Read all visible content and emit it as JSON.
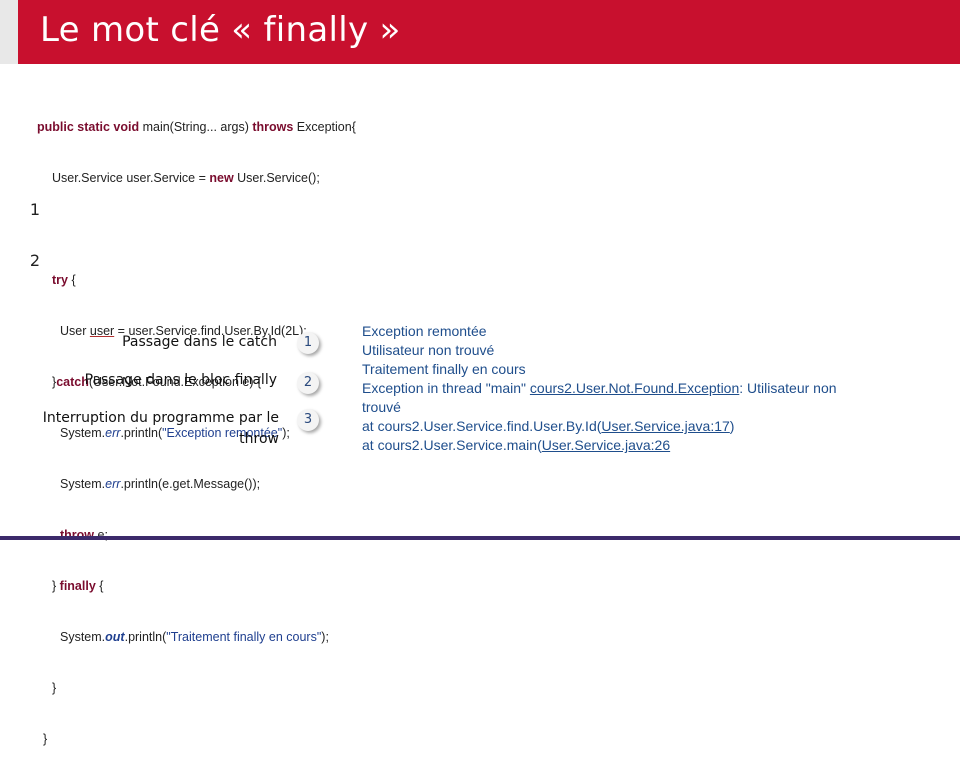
{
  "header": {
    "title": "Le mot clé « finally »"
  },
  "code": {
    "l1_kw1": "public static void",
    "l1_rest": " main(String... args) ",
    "l1_kw2": "throws",
    "l1_end": " Exception{",
    "l2_a": "User.Service user.Service = ",
    "l2_kw": "new",
    "l2_b": " User.Service();",
    "l3_kw": "try",
    "l3_end": " {",
    "l4_a": "User ",
    "l4_var": "user",
    "l4_b": " = user.Service.find.User.By.Id(2L);",
    "l5_a": "}",
    "l5_kw": "catch",
    "l5_b": "(User.Not.Found.Exception e) {",
    "l6_a": "System.",
    "l6_err": "err",
    "l6_b": ".println(",
    "l6_str": "\"Exception remontée\"",
    "l6_c": ");",
    "l7_a": "System.",
    "l7_err": "err",
    "l7_b": ".println(e.get.Message());",
    "l8_kw": "throw",
    "l8_b": " e;",
    "l9_a": "} ",
    "l9_kw": "finally",
    "l9_b": " {",
    "l10_a": "System.",
    "l10_out": "out",
    "l10_b": ".println(",
    "l10_str": "\"Traitement finally en cours\"",
    "l10_c": ");",
    "l11": "}",
    "l12": "}"
  },
  "markers": {
    "m1": "1",
    "m2": "2"
  },
  "legend": [
    {
      "label": "Passage dans le catch",
      "num": "1"
    },
    {
      "label": "Passage dans le bloc finally",
      "num": "2"
    },
    {
      "label": "Interruption du programme par le throw",
      "num": "3"
    }
  ],
  "output": {
    "line1": "Exception remontée",
    "line2": "Utilisateur non  trouvé",
    "line3": "Traitement finally en cours",
    "line4_a": "Exception in thread \"main\" ",
    "line4_link": "cours2.User.Not.Found.Exception",
    "line4_b": ": Utilisateur non",
    "line5": "trouvé",
    "line6_a": "at cours2.User.Service.find.User.By.Id(",
    "line6_link": "User.Service.java:17",
    "line6_b": ")",
    "line7_a": "at cours2.User.Service.main(",
    "line7_link": "User.Service.java:26"
  }
}
